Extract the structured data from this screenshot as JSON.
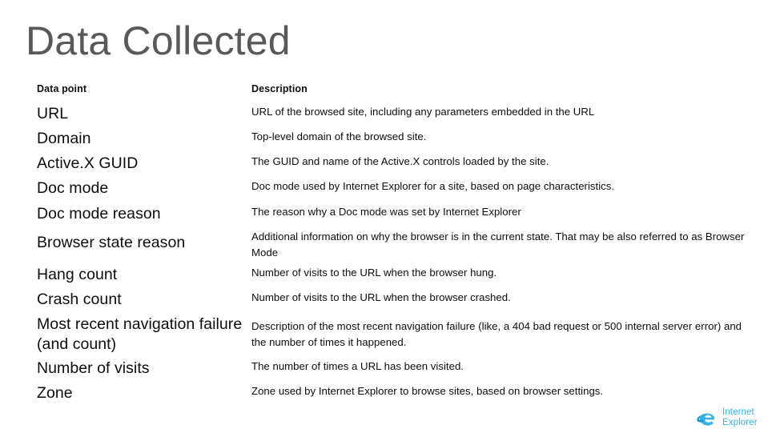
{
  "slide": {
    "title": "Data Collected"
  },
  "table": {
    "headers": {
      "data_point": "Data point",
      "description": "Description"
    },
    "rows": [
      {
        "data_point": "URL",
        "description": "URL of the browsed site, including any parameters embedded in the URL"
      },
      {
        "data_point": "Domain",
        "description": "Top-level domain of the browsed site."
      },
      {
        "data_point": "Active.X GUID",
        "description": "The GUID and name of the Active.X controls loaded by the site."
      },
      {
        "data_point": "Doc mode",
        "description": "Doc mode used by Internet Explorer for a site, based on page characteristics."
      },
      {
        "data_point": "Doc mode reason",
        "description": "The reason why a Doc mode was set by Internet Explorer"
      },
      {
        "data_point": "Browser state reason",
        "description": "Additional information on why the browser is in the current state. That may be also referred to as Browser Mode"
      },
      {
        "data_point": "Hang count",
        "description": "Number of visits to the URL when the browser hung."
      },
      {
        "data_point": "Crash count",
        "description": "Number of visits to the URL when the browser crashed."
      },
      {
        "data_point": "Most recent navigation failure (and count)",
        "description": "Description of the most recent navigation failure (like, a 404 bad request or 500 internal server error) and the number of times it happened."
      },
      {
        "data_point": "Number of visits",
        "description": "The number of times a URL has been visited."
      },
      {
        "data_point": "Zone",
        "description": "Zone used by Internet Explorer to browse sites, based on browser settings."
      }
    ]
  },
  "logo": {
    "line1": "Internet",
    "line2": "Explorer",
    "mark_color_light": "#35b4e4",
    "mark_color_dark": "#1a8fd0"
  },
  "colors": {
    "title": "#595959",
    "body_text": "#0d0d0d",
    "background": "#ffffff",
    "logo_blue": "#3ab0e0"
  }
}
